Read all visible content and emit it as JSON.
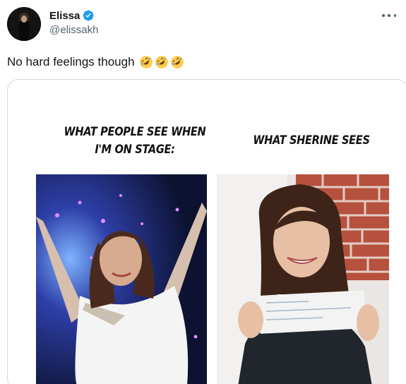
{
  "author": {
    "display_name": "Elissa",
    "handle": "@elissakh",
    "verified_icon": "verified-badge-icon",
    "avatar_icon": "profile-avatar"
  },
  "tweet": {
    "text": "No hard feelings though",
    "emojis": [
      "rolling-on-floor-laughing-emoji",
      "rolling-on-floor-laughing-emoji",
      "rolling-on-floor-laughing-emoji"
    ]
  },
  "menu": {
    "icon": "more-options-icon"
  },
  "media": {
    "caption_left_line1": "WHAT PEOPLE SEE WHEN",
    "caption_left_line2": "I'M ON STAGE:",
    "caption_right": "WHAT SHERINE SEES",
    "left_photo": "singer-on-stage-photo",
    "right_photo": "woman-holding-check-photo"
  },
  "colors": {
    "verified_blue": "#1d9bf0",
    "text_primary": "#0f1419",
    "text_secondary": "#536471",
    "border": "#cfd9de"
  }
}
